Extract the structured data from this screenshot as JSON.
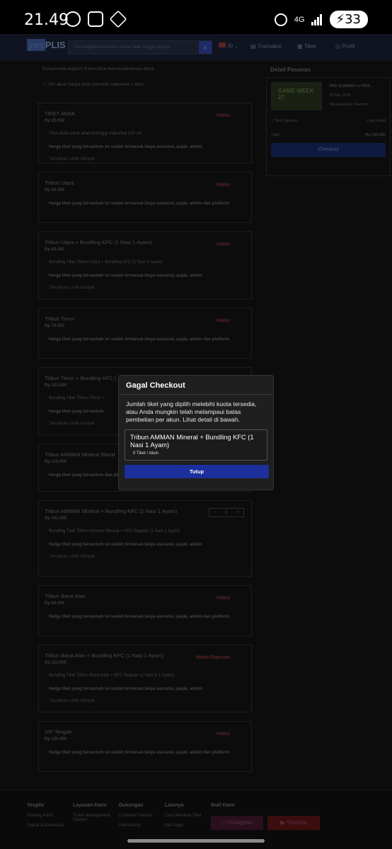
{
  "status_bar": {
    "time": "21.49",
    "network": "4G",
    "battery": "33"
  },
  "navbar": {
    "logo_prefix": "yes",
    "logo_suffix": "PLIS",
    "search_placeholder": "Cari kegiatan/kuis/artis, acara, tiket, hingga tempat",
    "lang": "ID",
    "links": [
      "Transaksi",
      "Tiket",
      "Profil"
    ]
  },
  "promo": {
    "coupon": "Punya kode kupon? Kamu bisa memasukkannya disini",
    "limit": "Per akun hanya bisa membeli maksimal 1 tiket."
  },
  "tickets": [
    {
      "title": "TIKET ANAK",
      "price": "Rp 25.000",
      "status": "Habis",
      "desc": "Tiket anak untuk anak bertinggi maksimal 120 cm.",
      "note": "Harga tiket yang tercantum ini sudah termasuk biaya asuransi, pajak, admin",
      "more": "Tampilkan Lebih Banyak"
    },
    {
      "title": "Tribun Utara",
      "price": "Rp 50.000",
      "status": "Habis",
      "desc": "",
      "note": "Harga tiket yang tercantum ini sudah termasuk biaya asuransi, pajak, admin dan platform.",
      "more": ""
    },
    {
      "title": "Tribun Utara + Bundling KFC (1 Nasi 1 Ayam)",
      "price": "Rp 83.000",
      "status": "Habis",
      "desc": "Bundling Tiket Tribun Utara + Bundling KFC (1 Nasi 1 Ayam)",
      "note": "Harga tiket yang tercantum ini sudah termasuk biaya asuransi, pajak, admin",
      "more": "Tampilkan Lebih Banyak"
    },
    {
      "title": "Tribun Timur",
      "price": "Rp 70.000",
      "status": "Habis",
      "desc": "",
      "note": "Harga tiket yang tercantum ini sudah termasuk biaya asuransi, pajak, admin dan platform.",
      "more": ""
    },
    {
      "title": "Tribun Timur + Bundling KFC (",
      "price": "Rp 103.000",
      "status": "",
      "desc": "Bundling Tiket Tribun Timur +",
      "note": "Harga tiket yang tercantum",
      "more": "Tampilkan Lebih Banyak"
    },
    {
      "title": "Tribun AMMAN Mineral (Barat",
      "price": "Rp 110.000",
      "status": "",
      "desc": "",
      "note": "Harga tiket yang tercantum dan platform.",
      "more": ""
    },
    {
      "title": "Tribun AMMAN Mineral + Bundling KFC (1 Nasi 1 Ayam)",
      "price": "Rp 143.000",
      "status": "",
      "desc": "Bundling Tiket Tribun Amman Mineral + KFC Reguler (1 Nasi 1 Ayam)",
      "note": "Harga tiket yang tercantum ini sudah termasuk biaya asuransi, pajak, admin",
      "more": "Tampilkan Lebih Banyak",
      "qty": "1"
    },
    {
      "title": "Tribun Barat Atas",
      "price": "Rp 80.000",
      "status": "Habis",
      "desc": "",
      "note": "Harga tiket yang tercantum ini sudah termasuk biaya asuransi, pajak, admin dan platform.",
      "more": ""
    },
    {
      "title": "Tribun Barat Atas + Bundling KFC (1 Nasi 1 Ayam)",
      "price": "Rp 113.000",
      "status": "Habis Dipesan",
      "desc": "Bundling Tiket Tribun Barat Atas + KFC Reguler (1 Nasi & 1 Ayam)",
      "note": "Harga tiket yang tercantum ini sudah termasuk biaya asuransi, pajak, admin",
      "more": "Tampilkan Lebih Banyak"
    },
    {
      "title": "VIP Tengah",
      "price": "Rp 150.000",
      "status": "Habis",
      "desc": "",
      "note": "Harga tiket yang tercantum ini sudah termasuk biaya asuransi, pajak, admin dan platform.",
      "more": ""
    }
  ],
  "order": {
    "heading": "Detail Pesanan",
    "image_text": "GAME WEEK 27",
    "match": "PSS SLEMAN vs PSIS...",
    "date": "03 Mei 2026",
    "venue": "Maguwoharjo Stadium",
    "tickets_label": "1 Tiket Dipesan",
    "detail_link": "Lihat Detail",
    "total_label": "Total",
    "total_value": "Rp 143.000",
    "checkout": "Checkout"
  },
  "modal": {
    "title": "Gagal Checkout",
    "message": "Jumlah tiket yang dipilih melebihi kuota tersedia, atau Anda mungkin telah melampaui batas pembelian per akun. Lihat detail di bawah.",
    "item": "Tribun AMMAN Mineral + Bundling KFC (1 Nasi 1 Ayam)",
    "quota": "0 Tiket / Akun",
    "close": "Tutup"
  },
  "footer": {
    "cols": [
      {
        "title": "Yesplis",
        "items": [
          "Tentang Kami",
          "Syarat & Ketentuan"
        ]
      },
      {
        "title": "Layanan Kami",
        "items": [
          "Ticket Management System"
        ]
      },
      {
        "title": "Dukungan",
        "items": [
          "Customer Service",
          "Partnership"
        ]
      },
      {
        "title": "Lainnya",
        "items": [
          "Cara Membeli Tiket",
          "Mini Apps"
        ]
      },
      {
        "title": "Ikuti Kami",
        "items": []
      }
    ],
    "instagram": "Instagram",
    "youtube": "Youtube"
  }
}
